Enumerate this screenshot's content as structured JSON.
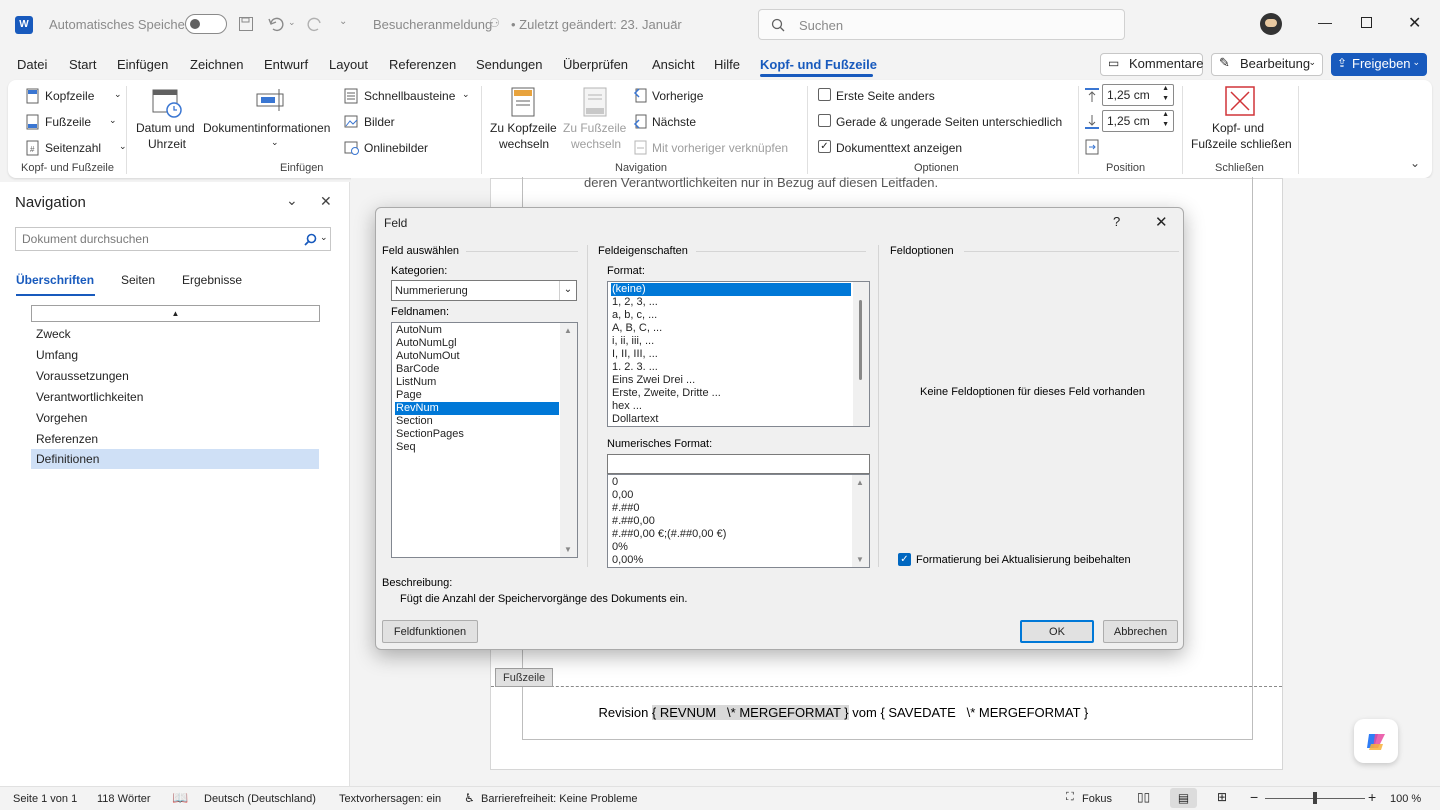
{
  "titlebar": {
    "autosave_label": "Automatisches Speichern",
    "doc_name": "Besucheranmeldung",
    "last_changed": "• Zuletzt geändert: 23. Januar",
    "search_placeholder": "Suchen"
  },
  "menu": {
    "items": [
      "Datei",
      "Start",
      "Einfügen",
      "Zeichnen",
      "Entwurf",
      "Layout",
      "Referenzen",
      "Sendungen",
      "Überprüfen",
      "Ansicht",
      "Hilfe",
      "Kopf- und Fußzeile"
    ],
    "active": "Kopf- und Fußzeile",
    "comments": "Kommentare",
    "editing": "Bearbeitung",
    "share": "Freigeben"
  },
  "ribbon": {
    "hf_group": {
      "header": "Kopfzeile",
      "footer": "Fußzeile",
      "page_number": "Seitenzahl",
      "label": "Kopf- und Fußzeile"
    },
    "insert_group": {
      "date_time_1": "Datum und",
      "date_time_2": "Uhrzeit",
      "doc_info": "Dokumentinformationen",
      "quick_parts": "Schnellbausteine",
      "pictures": "Bilder",
      "online_pictures": "Onlinebilder",
      "label": "Einfügen"
    },
    "nav_group": {
      "goto_header_1": "Zu Kopfzeile",
      "goto_header_2": "wechseln",
      "goto_footer_1": "Zu Fußzeile",
      "goto_footer_2": "wechseln",
      "previous": "Vorherige",
      "next": "Nächste",
      "link_previous": "Mit vorheriger verknüpfen",
      "label": "Navigation"
    },
    "options_group": {
      "first_page": "Erste Seite anders",
      "odd_even": "Gerade & ungerade Seiten unterschiedlich",
      "show_text": "Dokumenttext anzeigen",
      "label": "Optionen"
    },
    "position_group": {
      "header_pos": "1,25 cm",
      "footer_pos": "1,25 cm",
      "label": "Position"
    },
    "close_group": {
      "close_1": "Kopf- und",
      "close_2": "Fußzeile schließen",
      "label": "Schließen"
    }
  },
  "nav_pane": {
    "title": "Navigation",
    "search_placeholder": "Dokument durchsuchen",
    "tabs": [
      "Überschriften",
      "Seiten",
      "Ergebnisse"
    ],
    "headings": [
      "Zweck",
      "Umfang",
      "Voraussetzungen",
      "Verantwortlichkeiten",
      "Vorgehen",
      "Referenzen",
      "Definitionen"
    ],
    "selected": "Definitionen"
  },
  "document": {
    "body_line": "deren Verantwortlichkeiten nur in Bezug auf diesen Leitfaden.",
    "footer_tab": "Fußzeile",
    "footer_prefix": "Revision ",
    "field1": "{ REVNUM   \\* MERGEFORMAT }",
    "footer_mid": " vom ",
    "field2": "{ SAVEDATE   \\* MERGEFORMAT }"
  },
  "dialog": {
    "title": "Feld",
    "help": "?",
    "select_field": "Feld auswählen",
    "categories_label": "Kategorien:",
    "category_value": "Nummerierung",
    "field_names_label": "Feldnamen:",
    "field_names": [
      "AutoNum",
      "AutoNumLgl",
      "AutoNumOut",
      "BarCode",
      "ListNum",
      "Page",
      "RevNum",
      "Section",
      "SectionPages",
      "Seq"
    ],
    "selected_field": "RevNum",
    "field_props": "Feldeigenschaften",
    "format_label": "Format:",
    "formats": [
      "(keine)",
      "1, 2, 3, ...",
      "a, b, c, ...",
      "A, B, C, ...",
      "i, ii, iii, ...",
      "I, II, III, ...",
      "1. 2. 3. ...",
      "Eins Zwei Drei ...",
      "Erste, Zweite, Dritte ...",
      "hex ...",
      "Dollartext"
    ],
    "selected_format": "(keine)",
    "numeric_format_label": "Numerisches Format:",
    "numeric_formats": [
      "0",
      "0,00",
      "#.##0",
      "#.##0,00",
      "#.##0,00 €;(#.##0,00 €)",
      "0%",
      "0,00%"
    ],
    "field_options": "Feldoptionen",
    "no_options": "Keine Feldoptionen für dieses Feld vorhanden",
    "preserve_format": "Formatierung bei Aktualisierung beibehalten",
    "description_label": "Beschreibung:",
    "description": "Fügt die Anzahl der Speichervorgänge des Dokuments ein.",
    "field_codes_button": "Feldfunktionen",
    "ok_button": "OK",
    "cancel_button": "Abbrechen"
  },
  "statusbar": {
    "page": "Seite 1 von 1",
    "words": "118 Wörter",
    "language": "Deutsch (Deutschland)",
    "predictions": "Textvorhersagen: ein",
    "accessibility": "Barrierefreiheit: Keine Probleme",
    "focus": "Fokus",
    "zoom": "100 %"
  },
  "colors": {
    "accent": "#185abd",
    "share_bg": "#185abd",
    "selection": "#0078d7",
    "nav_selected": "#cfe0f6"
  }
}
